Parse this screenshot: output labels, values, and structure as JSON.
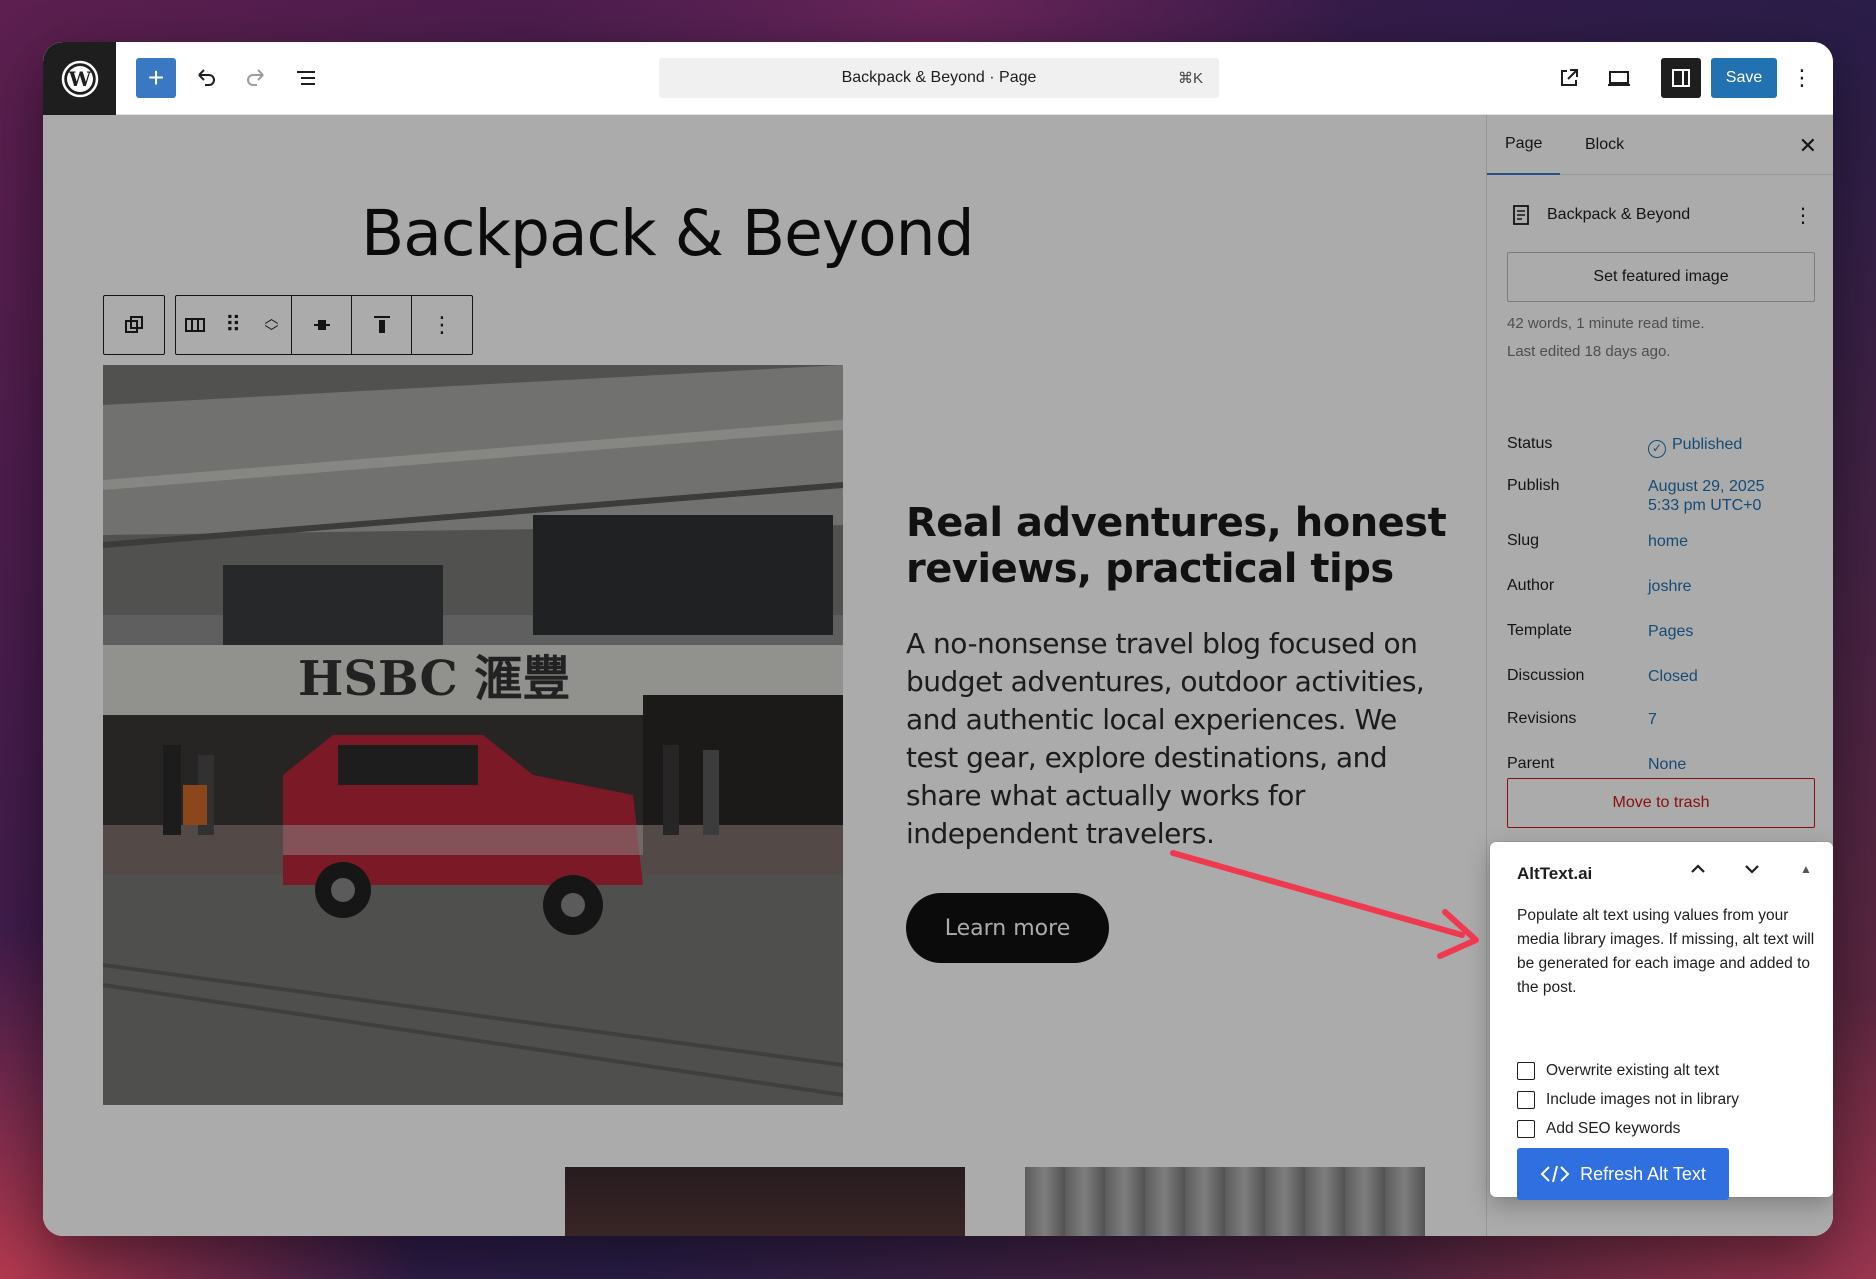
{
  "topbar": {
    "command_title": "Backpack & Beyond · Page",
    "command_shortcut": "⌘K",
    "save_label": "Save"
  },
  "canvas": {
    "page_title": "Backpack & Beyond",
    "hero_heading": "Real adventures, honest reviews, practical tips",
    "hero_text": "A no-nonsense travel blog focused on budget adventures, outdoor activities, and authentic local experiences. We test gear, explore destinations, and share what actually works for independent travelers.",
    "learn_more_label": "Learn more",
    "photo_signage": "HSBC 滙豐"
  },
  "sidebar": {
    "tabs": [
      {
        "label": "Page",
        "active": true
      },
      {
        "label": "Block",
        "active": false
      }
    ],
    "doc_title": "Backpack & Beyond",
    "featured_image_label": "Set featured image",
    "meta_words": "42 words, 1 minute read time.",
    "meta_edited": "Last edited 18 days ago.",
    "rows": {
      "status": {
        "label": "Status",
        "value": "Published"
      },
      "publish": {
        "label": "Publish",
        "value_line1": "August 29, 2025",
        "value_line2": "5:33 pm UTC+0"
      },
      "slug": {
        "label": "Slug",
        "value": "home"
      },
      "author": {
        "label": "Author",
        "value": "joshre"
      },
      "template": {
        "label": "Template",
        "value": "Pages"
      },
      "discussion": {
        "label": "Discussion",
        "value": "Closed"
      },
      "revisions": {
        "label": "Revisions",
        "value": "7"
      },
      "parent": {
        "label": "Parent",
        "value": "None"
      }
    },
    "trash_label": "Move to trash"
  },
  "alttext_panel": {
    "title": "AltText.ai",
    "description": "Populate alt text using values from your media library images. If missing, alt text will be generated for each image and added to the post.",
    "options": [
      {
        "label": "Overwrite existing alt text",
        "checked": false
      },
      {
        "label": "Include images not in library",
        "checked": false
      },
      {
        "label": "Add SEO keywords",
        "checked": false
      }
    ],
    "refresh_label": "Refresh Alt Text"
  },
  "colors": {
    "wp_blue": "#2271b1",
    "altText_blue": "#2f6fe0",
    "trash_red": "#cc1818",
    "annotation_arrow": "#f0394f"
  }
}
